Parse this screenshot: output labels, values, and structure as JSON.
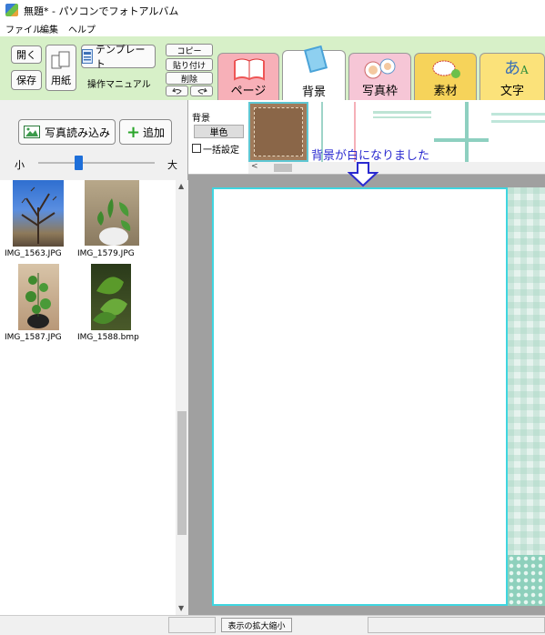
{
  "window": {
    "title": "無題* - パソコンでフォトアルバム"
  },
  "menu": [
    "ファイル",
    "編集",
    "ヘルプ"
  ],
  "toolbar": {
    "open": "開く",
    "save": "保存",
    "paper": "用紙",
    "template": "テンプレート",
    "manual": "操作マニュアル",
    "copy": "コピー",
    "paste": "貼り付け",
    "delete": "削除",
    "undo_icon": "undo-icon",
    "redo_icon": "redo-icon"
  },
  "tabs": [
    {
      "label": "ページ",
      "color": "#f7b0b8"
    },
    {
      "label": "背景",
      "color": "#ffffff"
    },
    {
      "label": "写真枠",
      "color": "#f6c6d6"
    },
    {
      "label": "素材",
      "color": "#f6d35a"
    },
    {
      "label": "文字",
      "color": "#fbe27a"
    }
  ],
  "leftpanel": {
    "import_button": "写真読み込み",
    "add_button": "追加",
    "size_small": "小",
    "size_large": "大",
    "thumb_size_value": 0.35
  },
  "photos": [
    {
      "name": "IMG_1563.JPG"
    },
    {
      "name": "IMG_1579.JPG"
    },
    {
      "name": "IMG_1587.JPG"
    },
    {
      "name": "IMG_1588.bmp"
    }
  ],
  "background_panel": {
    "label": "背景",
    "solid_button": "単色",
    "bulk_checkbox": "一括設定",
    "bulk_checked": false
  },
  "annotation": {
    "text": "背景が白になりました",
    "color": "#2a2ad0"
  },
  "statusbar": {
    "zoom_button": "表示の拡大縮小"
  },
  "colors": {
    "toolbar_bg": "#d7f0c8",
    "page_border": "#3fd6e0"
  }
}
